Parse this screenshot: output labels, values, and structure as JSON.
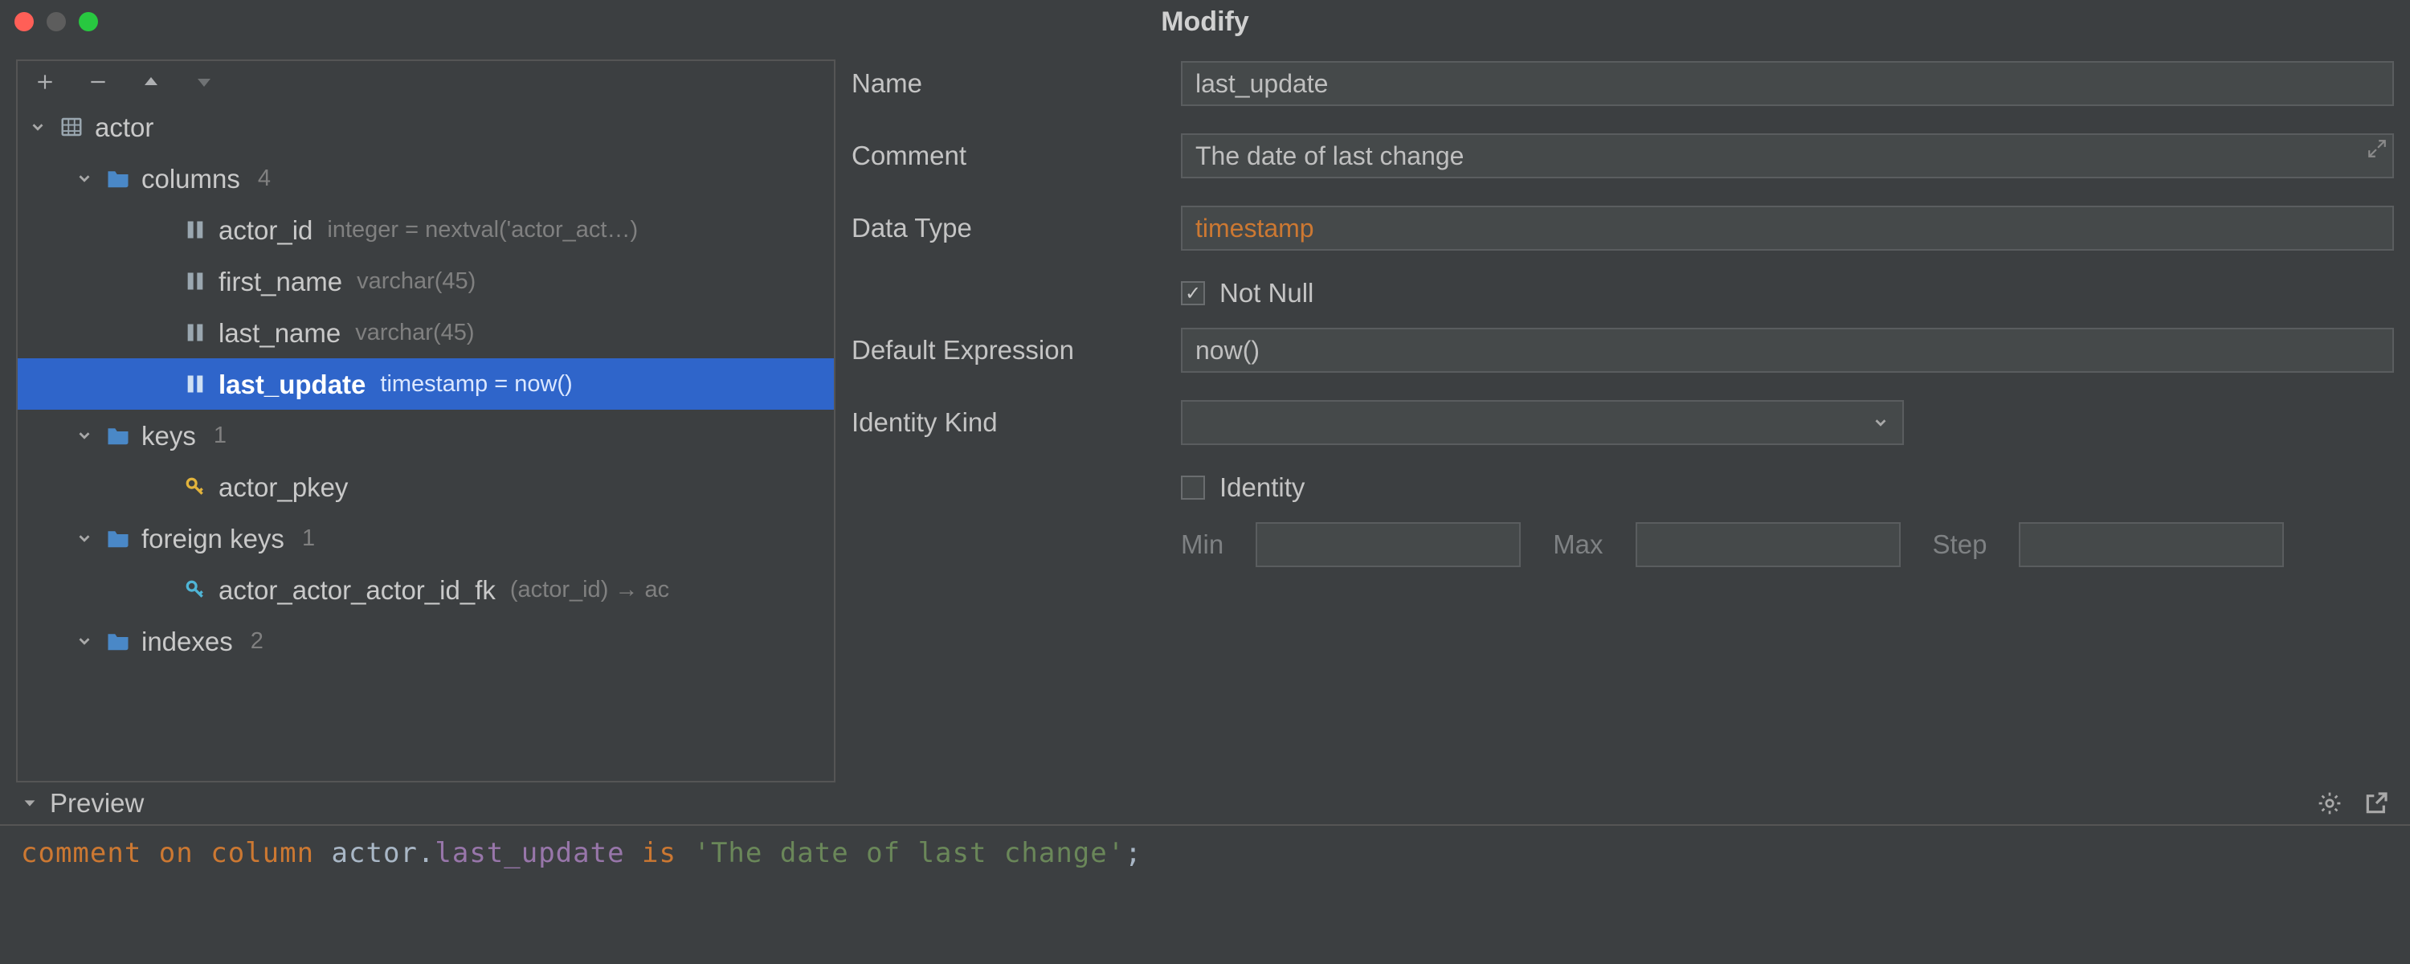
{
  "window": {
    "title": "Modify"
  },
  "tree": {
    "table": {
      "name": "actor"
    },
    "groups": {
      "columns": {
        "label": "columns",
        "count": "4"
      },
      "keys": {
        "label": "keys",
        "count": "1"
      },
      "foreign_keys": {
        "label": "foreign keys",
        "count": "1"
      },
      "indexes": {
        "label": "indexes",
        "count": "2"
      }
    },
    "columns": [
      {
        "name": "actor_id",
        "meta": "integer = nextval('actor_act…)"
      },
      {
        "name": "first_name",
        "meta": "varchar(45)"
      },
      {
        "name": "last_name",
        "meta": "varchar(45)"
      },
      {
        "name": "last_update",
        "meta": "timestamp = now()"
      }
    ],
    "keys": [
      {
        "name": "actor_pkey"
      }
    ],
    "fkeys": [
      {
        "name": "actor_actor_actor_id_fk",
        "meta": "(actor_id) → ac"
      }
    ]
  },
  "form": {
    "labels": {
      "name": "Name",
      "comment": "Comment",
      "data_type": "Data Type",
      "not_null": "Not Null",
      "default_expr": "Default Expression",
      "identity_kind": "Identity Kind",
      "identity": "Identity",
      "min": "Min",
      "max": "Max",
      "step": "Step"
    },
    "values": {
      "name": "last_update",
      "comment": "The date of last change",
      "data_type": "timestamp",
      "default_expr": "now()",
      "identity_kind": "",
      "min": "",
      "max": "",
      "step": ""
    },
    "checks": {
      "not_null": true,
      "identity": false
    }
  },
  "preview": {
    "label": "Preview",
    "sql": {
      "kw1": "comment",
      "kw2": "on",
      "kw3": "column",
      "schema": "actor",
      "dot": ".",
      "col": "last_update",
      "kw4": "is",
      "str": "'The date of last change'",
      "semi": ";"
    }
  }
}
